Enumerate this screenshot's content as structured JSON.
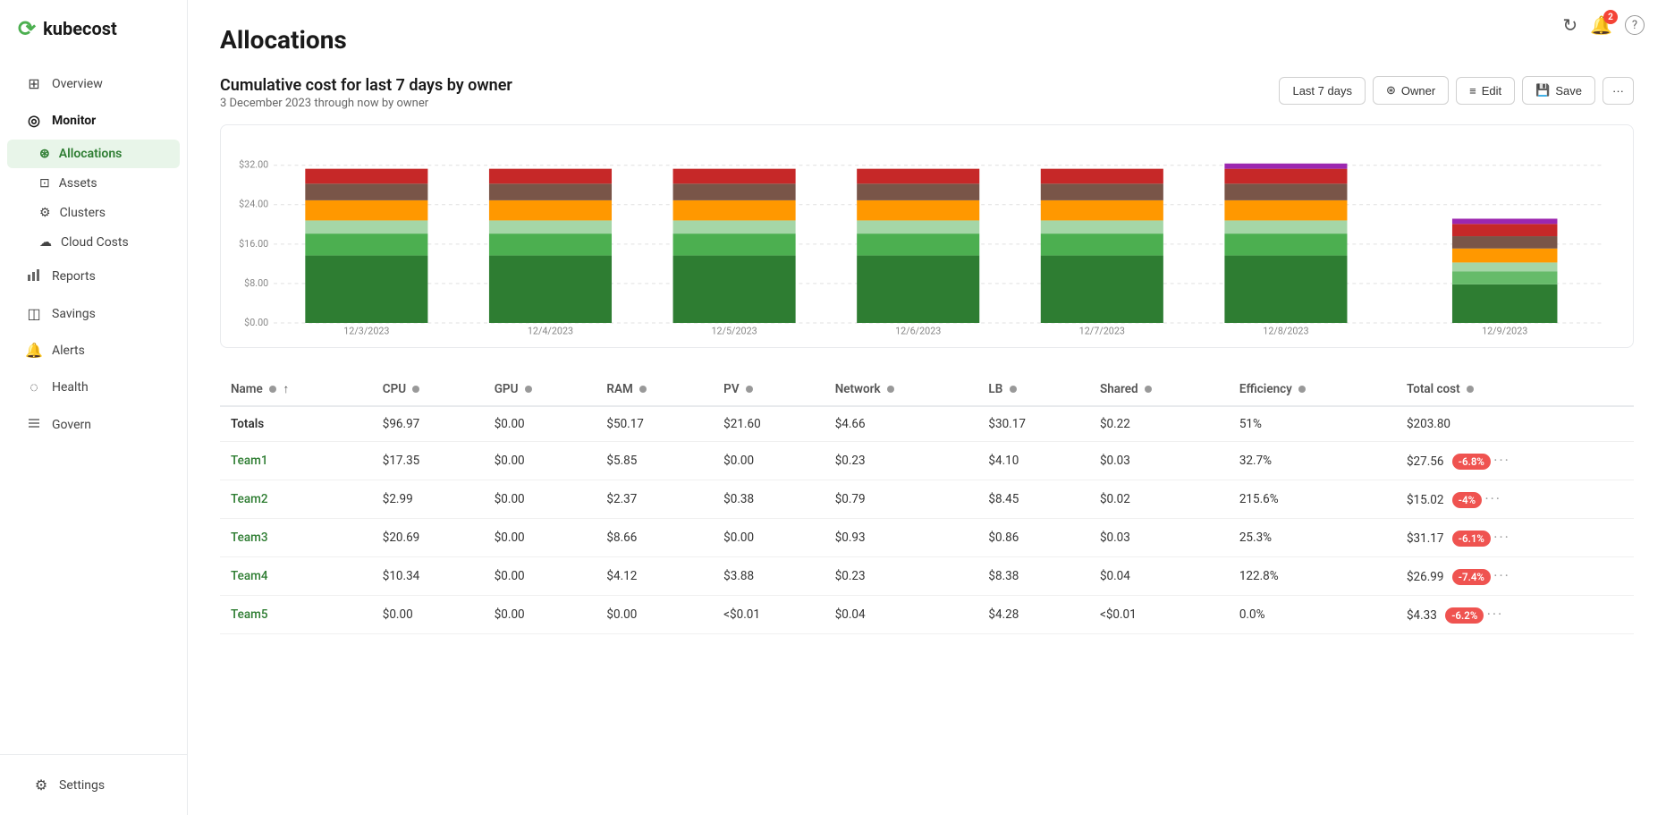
{
  "app": {
    "name": "kubecost",
    "logo_symbol": "♻"
  },
  "sidebar": {
    "items": [
      {
        "id": "overview",
        "label": "Overview",
        "icon": "⊞",
        "active": false,
        "level": "top"
      },
      {
        "id": "monitor",
        "label": "Monitor",
        "icon": "◎",
        "active": true,
        "level": "top"
      },
      {
        "id": "allocations",
        "label": "Allocations",
        "icon": "⊛",
        "active": true,
        "level": "sub"
      },
      {
        "id": "assets",
        "label": "Assets",
        "icon": "⊡",
        "active": false,
        "level": "sub"
      },
      {
        "id": "clusters",
        "label": "Clusters",
        "icon": "⚙",
        "active": false,
        "level": "sub"
      },
      {
        "id": "cloud-costs",
        "label": "Cloud Costs",
        "icon": "☁",
        "active": false,
        "level": "sub"
      },
      {
        "id": "reports",
        "label": "Reports",
        "icon": "📊",
        "active": false,
        "level": "top"
      },
      {
        "id": "savings",
        "label": "Savings",
        "icon": "⊟",
        "active": false,
        "level": "top"
      },
      {
        "id": "alerts",
        "label": "Alerts",
        "icon": "🔔",
        "active": false,
        "level": "top"
      },
      {
        "id": "health",
        "label": "Health",
        "icon": "◌",
        "active": false,
        "level": "top"
      },
      {
        "id": "govern",
        "label": "Govern",
        "icon": "⊜",
        "active": false,
        "level": "top"
      }
    ],
    "bottom": {
      "settings_label": "Settings",
      "settings_icon": "⚙"
    }
  },
  "page": {
    "title": "Allocations"
  },
  "chart": {
    "title": "Cumulative cost for last 7 days by owner",
    "subtitle": "3 December 2023 through now by owner",
    "controls": {
      "date_range": "Last 7 days",
      "group_by": "Owner",
      "edit_label": "Edit",
      "save_label": "Save",
      "more": "..."
    },
    "y_labels": [
      "$0.00",
      "$8.00",
      "$16.00",
      "$24.00",
      "$32.00"
    ],
    "x_labels": [
      "12/3/2023",
      "12/4/2023",
      "12/5/2023",
      "12/6/2023",
      "12/7/2023",
      "12/8/2023",
      "12/9/2023"
    ],
    "colors": {
      "dark_green": "#1b7a34",
      "medium_green": "#4caf50",
      "light_green": "#a5d6a7",
      "orange": "#ff9800",
      "brown": "#795548",
      "red": "#e53935",
      "purple": "#9c27b0",
      "teal": "#80cbc4",
      "lime": "#8bc34a"
    }
  },
  "table": {
    "columns": [
      {
        "id": "name",
        "label": "Name",
        "sortable": true
      },
      {
        "id": "cpu",
        "label": "CPU"
      },
      {
        "id": "gpu",
        "label": "GPU"
      },
      {
        "id": "ram",
        "label": "RAM"
      },
      {
        "id": "pv",
        "label": "PV"
      },
      {
        "id": "network",
        "label": "Network"
      },
      {
        "id": "lb",
        "label": "LB"
      },
      {
        "id": "shared",
        "label": "Shared"
      },
      {
        "id": "efficiency",
        "label": "Efficiency"
      },
      {
        "id": "total_cost",
        "label": "Total cost"
      }
    ],
    "totals_row": {
      "name": "Totals",
      "cpu": "$96.97",
      "gpu": "$0.00",
      "ram": "$50.17",
      "pv": "$21.60",
      "network": "$4.66",
      "lb": "$30.17",
      "shared": "$0.22",
      "efficiency": "51%",
      "total_cost": "$203.80",
      "badge": null
    },
    "rows": [
      {
        "name": "Team1",
        "cpu": "$17.35",
        "gpu": "$0.00",
        "ram": "$5.85",
        "pv": "$0.00",
        "network": "$0.23",
        "lb": "$4.10",
        "shared": "$0.03",
        "efficiency": "32.7%",
        "total_cost": "$27.56",
        "badge": "-6.8%",
        "badge_type": "red"
      },
      {
        "name": "Team2",
        "cpu": "$2.99",
        "gpu": "$0.00",
        "ram": "$2.37",
        "pv": "$0.38",
        "network": "$0.79",
        "lb": "$8.45",
        "shared": "$0.02",
        "efficiency": "215.6%",
        "total_cost": "$15.02",
        "badge": "-4%",
        "badge_type": "red"
      },
      {
        "name": "Team3",
        "cpu": "$20.69",
        "gpu": "$0.00",
        "ram": "$8.66",
        "pv": "$0.00",
        "network": "$0.93",
        "lb": "$0.86",
        "shared": "$0.03",
        "efficiency": "25.3%",
        "total_cost": "$31.17",
        "badge": "-6.1%",
        "badge_type": "red"
      },
      {
        "name": "Team4",
        "cpu": "$10.34",
        "gpu": "$0.00",
        "ram": "$4.12",
        "pv": "$3.88",
        "network": "$0.23",
        "lb": "$8.38",
        "shared": "$0.04",
        "efficiency": "122.8%",
        "total_cost": "$26.99",
        "badge": "-7.4%",
        "badge_type": "red"
      },
      {
        "name": "Team5",
        "cpu": "$0.00",
        "gpu": "$0.00",
        "ram": "$0.00",
        "pv": "<$0.01",
        "network": "$0.04",
        "lb": "$4.28",
        "shared": "<$0.01",
        "efficiency": "0.0%",
        "total_cost": "$4.33",
        "badge": "-6.2%",
        "badge_type": "red"
      }
    ]
  },
  "topbar": {
    "notification_count": "2",
    "refresh_icon": "↻",
    "bell_icon": "🔔",
    "help_icon": "?"
  }
}
